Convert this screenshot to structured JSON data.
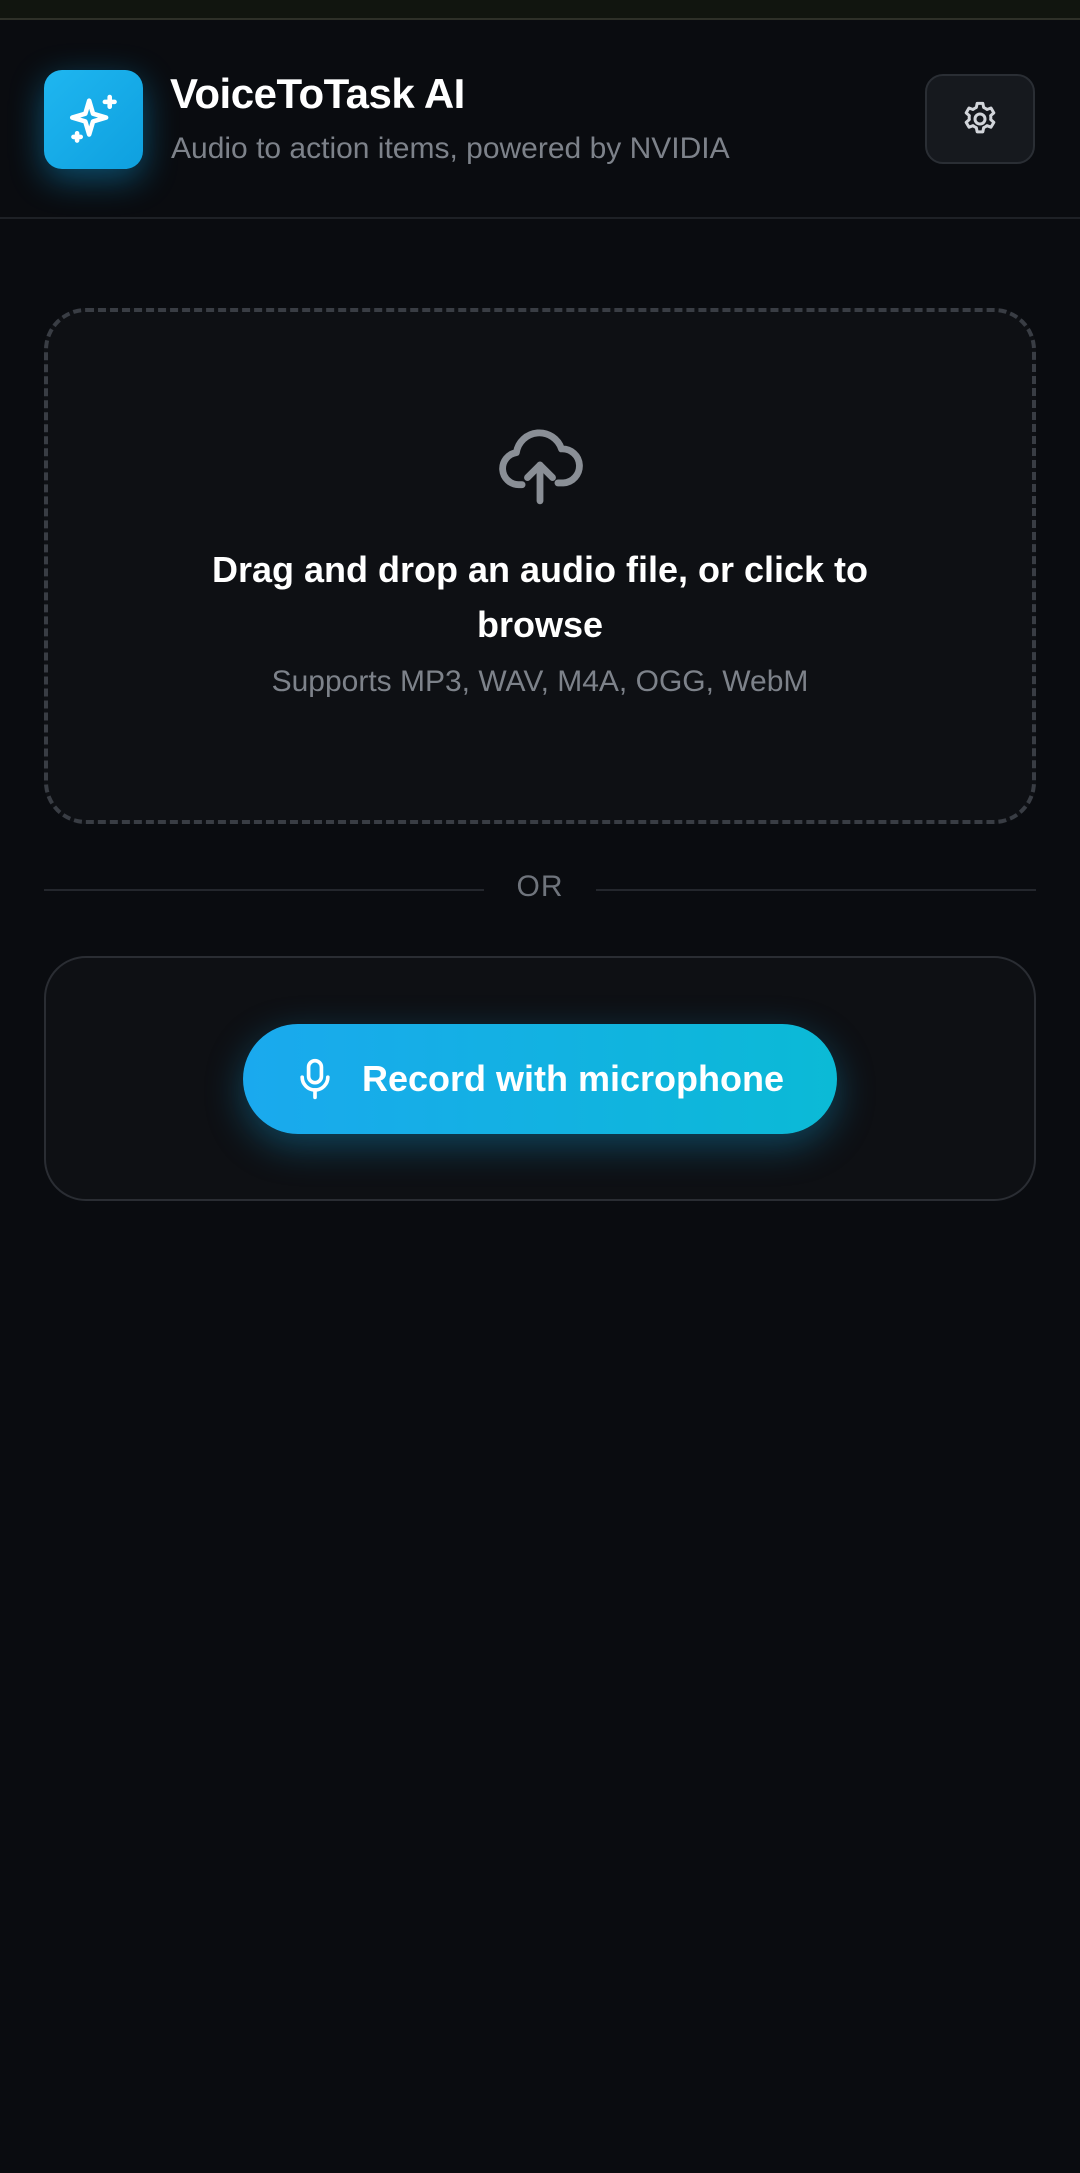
{
  "header": {
    "title": "VoiceToTask AI",
    "subtitle": "Audio to action items, powered by NVIDIA",
    "logo_icon": "sparkles-icon",
    "settings_icon": "gear-icon"
  },
  "dropzone": {
    "icon": "cloud-upload-icon",
    "title": "Drag and drop an audio file, or click to browse",
    "subtitle": "Supports MP3, WAV, M4A, OGG, WebM"
  },
  "divider": {
    "label": "OR"
  },
  "record": {
    "icon": "microphone-icon",
    "label": "Record with microphone"
  },
  "colors": {
    "background": "#0a0c10",
    "accent_start": "#1aa9ee",
    "accent_end": "#0bbad6",
    "muted_text": "#7d828a"
  }
}
